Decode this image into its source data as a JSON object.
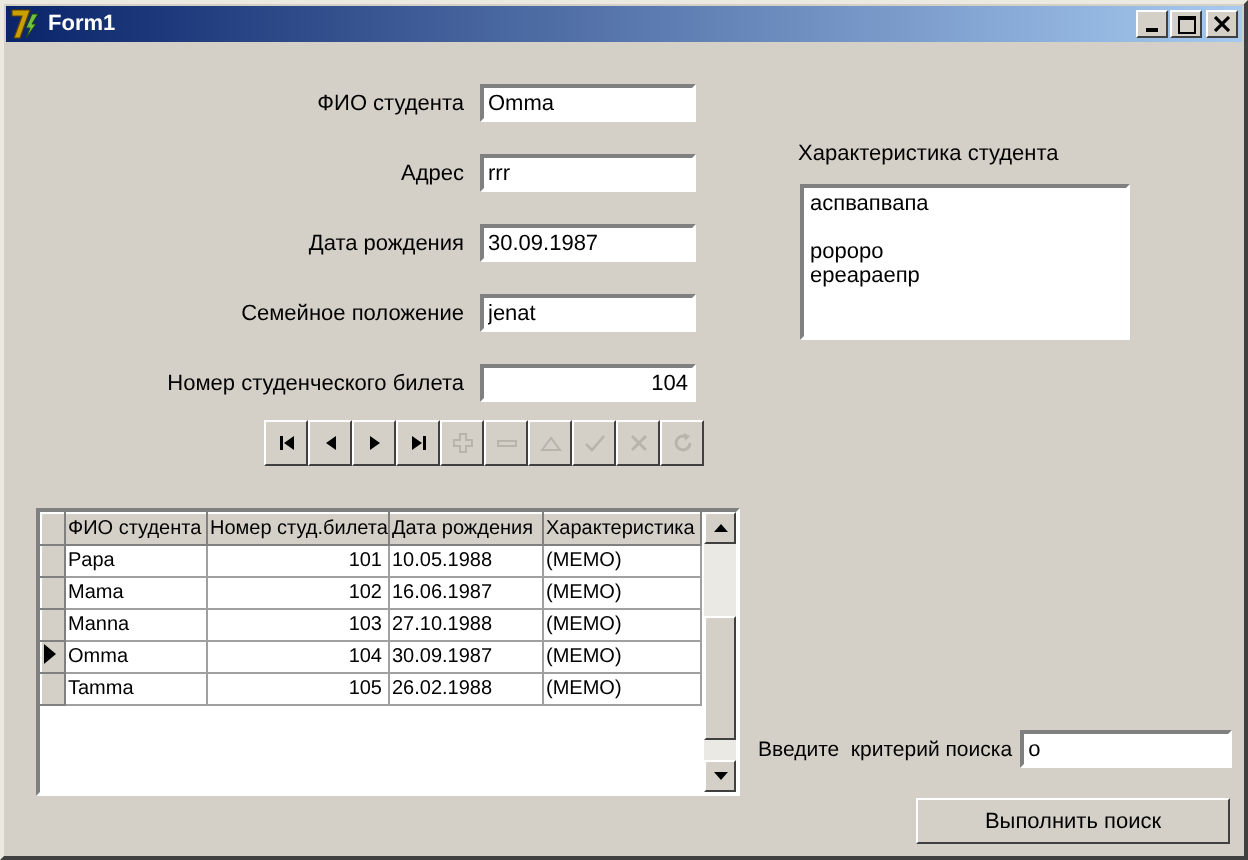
{
  "window": {
    "title": "Form1"
  },
  "fields": [
    {
      "label": "ФИО студента",
      "value": "Omma",
      "kind": "text"
    },
    {
      "label": "Адрес",
      "value": "rrr",
      "kind": "text"
    },
    {
      "label": "Дата рождения",
      "value": "30.09.1987",
      "kind": "text"
    },
    {
      "label": "Семейное положение",
      "value": "jenat",
      "kind": "text"
    },
    {
      "label": "Номер студенческого билета",
      "value": "104",
      "kind": "number"
    }
  ],
  "navigator": [
    {
      "kind": "first",
      "disabled": false
    },
    {
      "kind": "prior",
      "disabled": false
    },
    {
      "kind": "next",
      "disabled": false
    },
    {
      "kind": "last",
      "disabled": false
    },
    {
      "kind": "insert",
      "disabled": true
    },
    {
      "kind": "delete",
      "disabled": true
    },
    {
      "kind": "edit",
      "disabled": true
    },
    {
      "kind": "post",
      "disabled": true
    },
    {
      "kind": "cancel",
      "disabled": true
    },
    {
      "kind": "refresh",
      "disabled": true
    }
  ],
  "grid": {
    "columns": [
      "ФИО студента",
      "Номер студ.билета",
      "Дата рождения",
      "Характеристика"
    ],
    "rows": [
      {
        "cells": [
          "Papa",
          "101",
          "10.05.1988",
          "(MEMO)"
        ],
        "selected": false
      },
      {
        "cells": [
          "Mama",
          "102",
          "16.06.1987",
          "(MEMO)"
        ],
        "selected": false
      },
      {
        "cells": [
          "Manna",
          "103",
          "27.10.1988",
          "(MEMO)"
        ],
        "selected": false
      },
      {
        "cells": [
          "Omma",
          "104",
          "30.09.1987",
          "(MEMO)"
        ],
        "selected": true
      },
      {
        "cells": [
          "Tamma",
          "105",
          "26.02.1988",
          "(MEMO)"
        ],
        "selected": false
      }
    ]
  },
  "memo": {
    "label": "Характеристика студента",
    "value": "аспвапвапа\n\nророро\nереараепр"
  },
  "search": {
    "label": "Введите  критерий поиска",
    "value": "o",
    "button": "Выполнить поиск"
  }
}
